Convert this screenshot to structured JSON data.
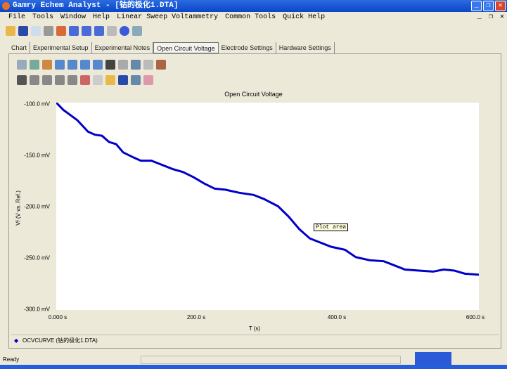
{
  "window": {
    "title": "Gamry Echem Analyst - [钴的极化1.DTA]"
  },
  "menu": [
    "File",
    "Tools",
    "Window",
    "Help",
    "Linear Sweep Voltammetry",
    "Common Tools",
    "Quick Help"
  ],
  "tabs": [
    "Chart",
    "Experimental Setup",
    "Experimental Notes",
    "Open Circuit Voltage",
    "Electrode Settings",
    "Hardware Settings"
  ],
  "active_tab": "Open Circuit Voltage",
  "tooltip": "Plot area",
  "status": "Ready",
  "chart_data": {
    "type": "line",
    "title": "Open Circuit Voltage",
    "xlabel": "T (s)",
    "ylabel": "Vf (V vs. Ref.)",
    "xlim": [
      0,
      600
    ],
    "ylim": [
      -300,
      -100
    ],
    "xticks": [
      "0.000 s",
      "200.0 s",
      "400.0 s",
      "600.0 s"
    ],
    "yticks": [
      "-100.0 mV",
      "-150.0 mV",
      "-200.0 mV",
      "-250.0 mV",
      "-300.0 mV"
    ],
    "series": [
      {
        "name": "OCVCURVE (钴的极化1.DTA)",
        "color": "#0000c8",
        "x": [
          0,
          10,
          20,
          30,
          45,
          55,
          65,
          75,
          85,
          95,
          110,
          120,
          135,
          150,
          165,
          180,
          195,
          210,
          225,
          240,
          260,
          280,
          295,
          315,
          330,
          345,
          360,
          375,
          390,
          410,
          425,
          445,
          465,
          480,
          495,
          515,
          535,
          550,
          565,
          580,
          600
        ],
        "y": [
          -100,
          -107,
          -112,
          -117,
          -128,
          -131,
          -132,
          -138,
          -140,
          -148,
          -153,
          -156,
          -156,
          -160,
          -164,
          -167,
          -172,
          -178,
          -183,
          -184,
          -187,
          -189,
          -193,
          -200,
          -210,
          -222,
          -231,
          -235,
          -239,
          -242,
          -249,
          -252,
          -253,
          -257,
          -261,
          -262,
          -263,
          -261,
          -262,
          -265,
          -266
        ]
      }
    ]
  }
}
